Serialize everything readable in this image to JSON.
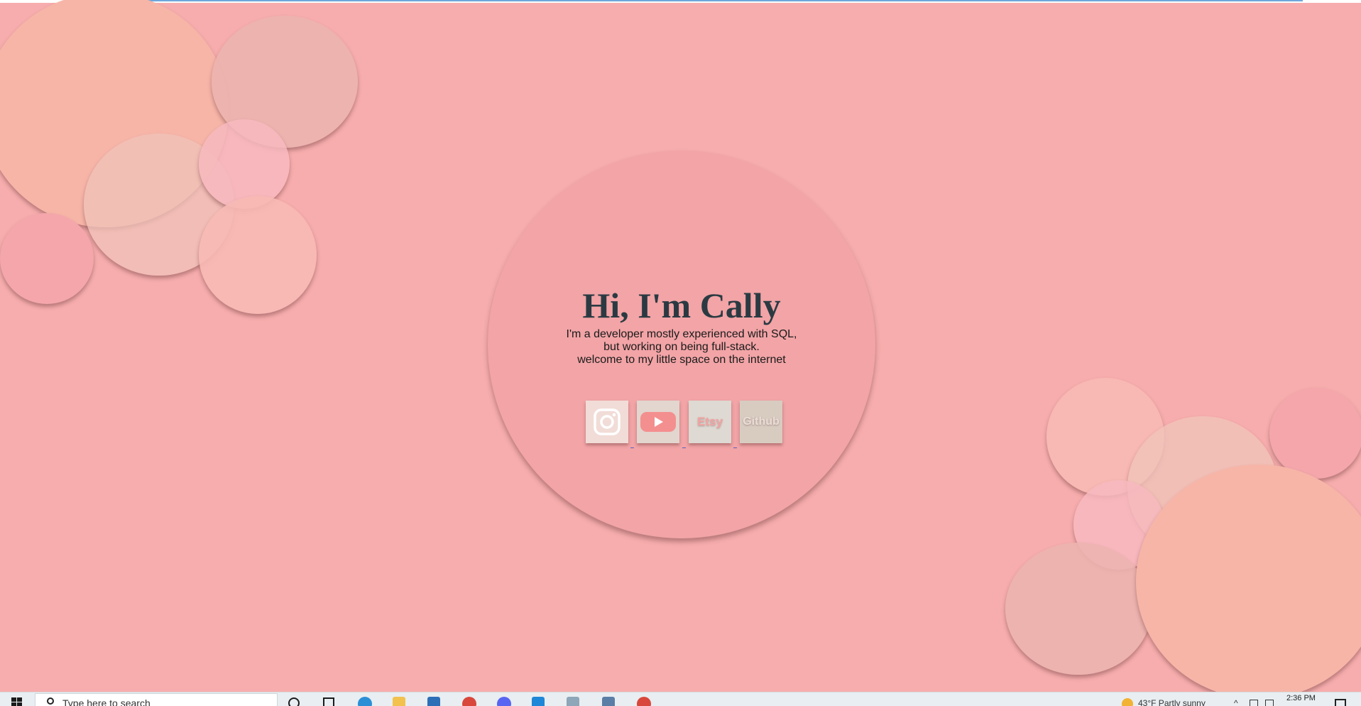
{
  "page": {
    "background_color": "#f7adad"
  },
  "hero": {
    "title": "Hi, I'm Cally",
    "lines": [
      "I'm a developer mostly experienced with SQL,",
      "but working on being full-stack.",
      "welcome to my little space on the internet"
    ]
  },
  "social_links": [
    {
      "name": "instagram",
      "icon": "instagram-icon",
      "bg": "#f1dcd7",
      "color": "#ffffff"
    },
    {
      "name": "youtube",
      "icon": "youtube-icon",
      "bg": "#e2d6cf",
      "color": "#f48f8f"
    },
    {
      "name": "etsy",
      "label": "Etsy",
      "bg": "#ded9d2",
      "color": "#f2a3a3"
    },
    {
      "name": "github",
      "label": "Github",
      "bg": "#d8ccc1",
      "color": "#eaded7"
    }
  ],
  "taskbar": {
    "search_placeholder": "Type here to search",
    "weather": "43°F  Partly sunny",
    "clock": "2:36 PM",
    "apps": [
      {
        "icon": "search-icon",
        "color": "#1b1b1b"
      },
      {
        "icon": "task-view-icon",
        "color": "#1b1b1b"
      },
      {
        "icon": "edge-icon",
        "color": "#2b8fd6"
      },
      {
        "icon": "file-explorer-icon",
        "color": "#f2c14e"
      },
      {
        "icon": "store-icon",
        "color": "#2d6fb7"
      },
      {
        "icon": "chrome-icon",
        "color": "#d9473c"
      },
      {
        "icon": "discord-icon",
        "color": "#5865f2"
      },
      {
        "icon": "vscode-icon",
        "color": "#1f87d8"
      },
      {
        "icon": "notepad-icon",
        "color": "#8da6b8"
      },
      {
        "icon": "calculator-icon",
        "color": "#5a7ea6"
      },
      {
        "icon": "chrome-icon",
        "color": "#d9473c"
      }
    ]
  }
}
